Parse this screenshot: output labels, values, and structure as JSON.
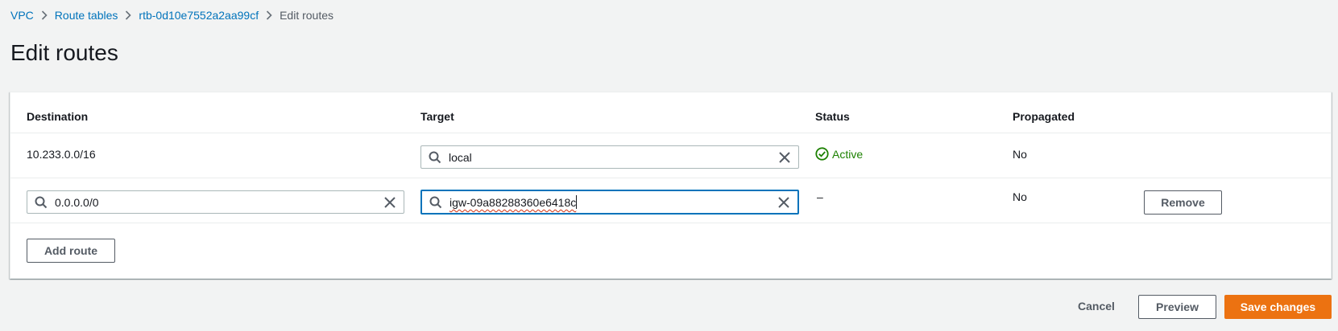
{
  "breadcrumb": {
    "items": [
      "VPC",
      "Route tables",
      "rtb-0d10e7552a2aa99cf"
    ],
    "current": "Edit routes"
  },
  "page": {
    "title": "Edit routes"
  },
  "table": {
    "headers": {
      "destination": "Destination",
      "target": "Target",
      "status": "Status",
      "propagated": "Propagated"
    },
    "rows": [
      {
        "destination": "10.233.0.0/16",
        "target": "local",
        "status": "Active",
        "propagated": "No"
      },
      {
        "destination": "0.0.0.0/0",
        "target": "igw-09a88288360e6418c",
        "status": "–",
        "propagated": "No",
        "remove_label": "Remove"
      }
    ],
    "add_route_label": "Add route"
  },
  "footer": {
    "cancel": "Cancel",
    "preview": "Preview",
    "save": "Save changes"
  },
  "colors": {
    "link": "#0073bb",
    "active": "#1d8102",
    "primary": "#ec7211",
    "focus": "#0073bb"
  },
  "icons": {
    "search": "search-icon",
    "clear": "clear-icon",
    "status": "check-circle-icon",
    "separator": "chevron-right-icon"
  }
}
